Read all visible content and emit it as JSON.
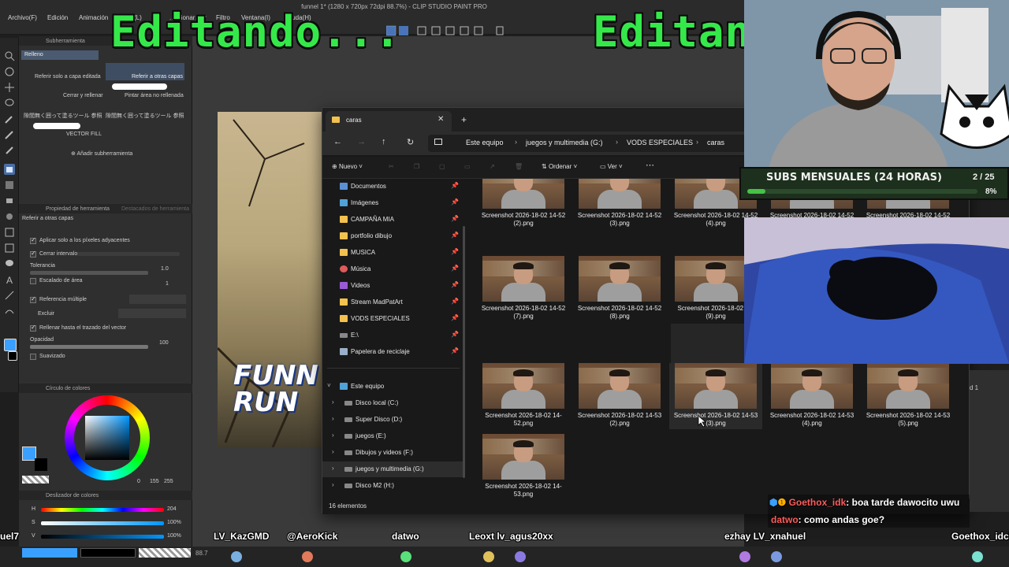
{
  "app": {
    "title": "funnel 1* (1280 x 720px 72dpi 88.7%) - CLIP STUDIO PAINT PRO",
    "menu": [
      "Archivo(F)",
      "Edición",
      "Animación",
      "(L)",
      "...ccionar",
      "...er",
      "Filtro",
      "Ventana(I)",
      "Ayuda(H)"
    ]
  },
  "overlay": {
    "left_text": "Editando...",
    "right_text": "Editand"
  },
  "subtool_panel": {
    "tab_label": "Subherramienta",
    "group_label": "Relleno",
    "items": [
      "Referir solo a capa editada",
      "Referir a otras capas",
      "Cerrar y rellenar",
      "Pintar área no rellenada",
      "隙間無く囲って塗るツール 参照",
      "隙間無く囲って塗るツール 参照",
      "VECTOR FILL"
    ],
    "add_label": "Añadir subherramienta"
  },
  "tool_property": {
    "tab_label": "Propiedad de herramienta",
    "tab2_label": "Destacados de herramienta",
    "title": "Referir a otras capas",
    "options": [
      {
        "label": "Aplicar solo a los píxeles adyacentes",
        "checked": true
      },
      {
        "label": "Cerrar intervalo",
        "checked": true
      },
      {
        "label": "Tolerancia",
        "value": "1.0"
      },
      {
        "label": "Escalado de área",
        "value": "1"
      },
      {
        "label": "Referencia múltiple",
        "checked": true
      },
      {
        "label": "Excluir"
      },
      {
        "label": "Rellenar hasta el trazado del vector",
        "checked": true
      },
      {
        "label": "Opacidad",
        "value": "100"
      },
      {
        "label": "Suavizado"
      }
    ]
  },
  "color_wheel": {
    "tab_label": "Círculo de colores",
    "values": [
      "0",
      "155",
      "255"
    ],
    "current_color": "#3aa0ff"
  },
  "color_slider": {
    "tab_label": "Deslizador de colores",
    "rows": [
      {
        "label": "H",
        "value": "204"
      },
      {
        "label": "S",
        "value": "100%"
      },
      {
        "label": "V",
        "value": "100%"
      }
    ]
  },
  "canvas": {
    "art_line1": "FUNN",
    "art_line2": "RUN",
    "zoom": "88.7"
  },
  "explorer": {
    "tab_title": "caras",
    "breadcrumbs": [
      "Este equipo",
      "juegos y multimedia (G:)",
      "VODS ESPECIALES",
      "caras"
    ],
    "commands": {
      "new": "Nuevo",
      "sort": "Ordenar",
      "view": "Ver"
    },
    "nav": [
      {
        "label": "Documentos",
        "icon": "document",
        "pinned": true
      },
      {
        "label": "Imágenes",
        "icon": "pictures",
        "pinned": true
      },
      {
        "label": "CAMPAÑA MIA",
        "icon": "folder",
        "pinned": true
      },
      {
        "label": "portfolio dibujo",
        "icon": "folder",
        "pinned": true
      },
      {
        "label": "MUSICA",
        "icon": "folder",
        "pinned": true
      },
      {
        "label": "Música",
        "icon": "music",
        "pinned": true
      },
      {
        "label": "Videos",
        "icon": "video",
        "pinned": true
      },
      {
        "label": "Stream MadPatArt",
        "icon": "folder",
        "pinned": true
      },
      {
        "label": "VODS ESPECIALES",
        "icon": "folder",
        "pinned": true
      },
      {
        "label": "E:\\",
        "icon": "drive",
        "pinned": true
      },
      {
        "label": "Papelera de reciclaje",
        "icon": "recycle-bin",
        "pinned": true
      }
    ],
    "this_pc": {
      "label": "Este equipo",
      "drives": [
        "Disco local (C:)",
        "Super Disco (D:)",
        "juegos (E:)",
        "Dibujos y videos (F:)",
        "juegos y multimedia (G:)",
        "Disco M2 (H:)"
      ]
    },
    "files_row1": [
      "Screenshot 2026-18-02 14-52 (2).png",
      "Screenshot 2026-18-02 14-52 (3).png",
      "Screenshot 2026-18-02 14-52 (4).png",
      "Screenshot 2026-18-02 14-52 (5).png",
      "Screenshot 2026-18-02 14-52 (6).png"
    ],
    "files_row2": [
      "Screenshot 2026-18-02 14-52 (7).png",
      "Screenshot 2026-18-02 14-52 (8).png",
      "Screenshot 2026-18-02 1... (9).png"
    ],
    "files_row3": [
      "Screenshot 2026-18-02 14-52.png",
      "Screenshot 2026-18-02 14-53 (2).png",
      "Screenshot 2026-18-02 14-53 (3).png",
      "Screenshot 2026-18-02 14-53 (4).png",
      "Screenshot 2026-18-02 14-53 (5).png"
    ],
    "files_row4": [
      "Screenshot 2026-18-02 14-53.png"
    ],
    "status": "16 elementos"
  },
  "stream": {
    "subs_title": "SUBS MENSUALES (24 HORAS)",
    "subs_count": "2 / 25",
    "subs_pct": "8%",
    "subs_fraction": 0.08,
    "chat": [
      {
        "user": "Goethox_idk",
        "text": ": boa tarde dawocito uwu",
        "color": "#ff5c5c"
      },
      {
        "user": "datwo",
        "text": ": como andas goe?",
        "color": "#ff5c5c"
      }
    ],
    "names": [
      "uel7",
      "LV_KazGMD",
      "@AeroKick",
      "datwo",
      "Leoxt lv_agus20xx",
      "ezhay LV_xnahuel",
      "Goethox_idch"
    ],
    "layer_label": "d 1"
  }
}
